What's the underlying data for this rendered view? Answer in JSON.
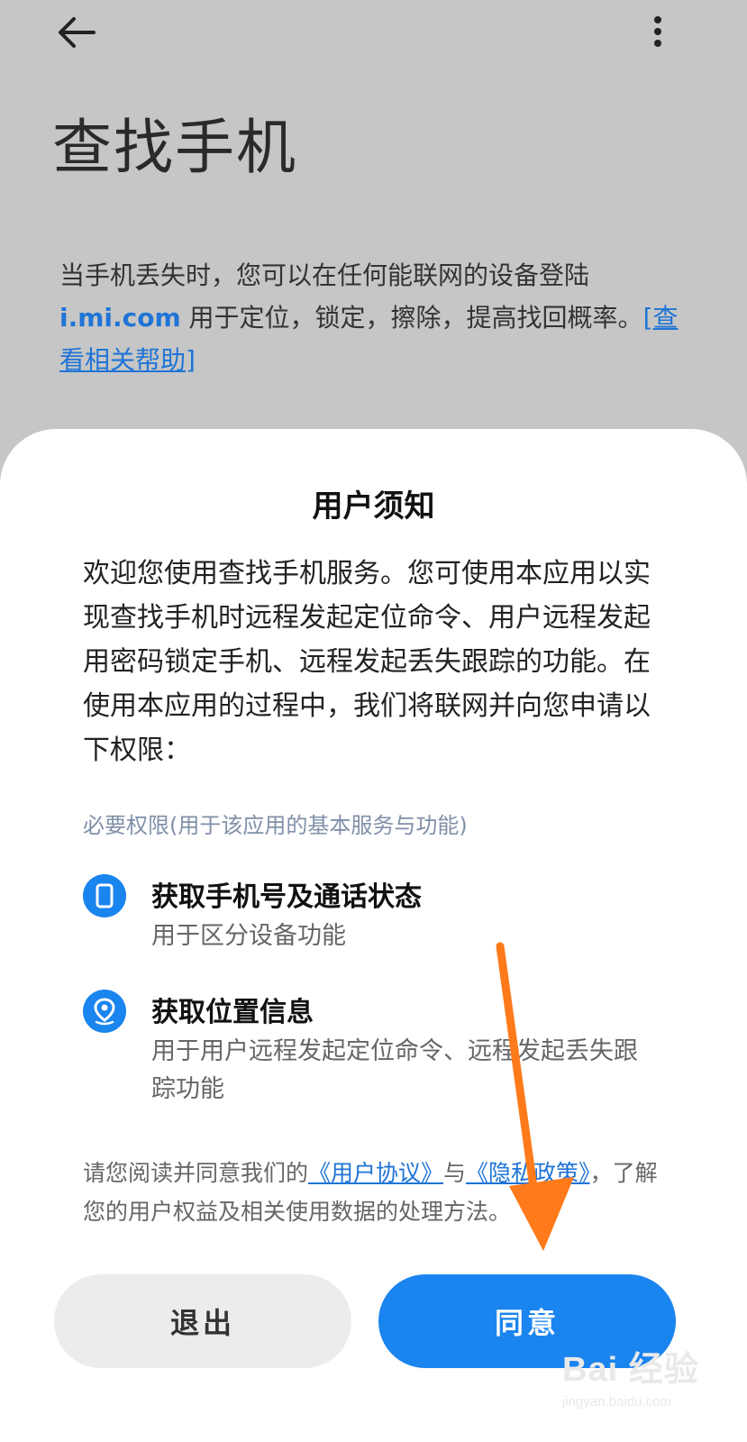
{
  "header": {
    "back_icon": "arrow-left-icon",
    "more_icon": "more-vertical-icon",
    "title": "查找手机"
  },
  "intro": {
    "text_before": "当手机丢失时，您可以在任何能联网的设备登陆",
    "domain": "i.mi.com",
    "text_after": " 用于定位，锁定，擦除，提高找回概率。",
    "help_link": "[查看相关帮助]"
  },
  "dialog": {
    "title": "用户须知",
    "body": "欢迎您使用查找手机服务。您可使用本应用以实现查找手机时远程发起定位命令、用户远程发起用密码锁定手机、远程发起丢失跟踪的功能。在使用本应用的过程中，我们将联网并向您申请以下权限：",
    "permissions_header": "必要权限(用于该应用的基本服务与功能)",
    "permissions": [
      {
        "icon": "phone-icon",
        "title": "获取手机号及通话状态",
        "desc": "用于区分设备功能"
      },
      {
        "icon": "location-pin-icon",
        "title": "获取位置信息",
        "desc": "用于用户远程发起定位命令、远程发起丢失跟踪功能"
      }
    ],
    "agreement": {
      "prefix": "请您阅读并同意我们的",
      "user_agreement": "《用户协议》",
      "and": "与",
      "privacy_policy": "《隐私政策》",
      "suffix": "，了解您的用户权益及相关使用数据的处理方法。"
    },
    "buttons": {
      "exit": "退出",
      "agree": "同意"
    }
  },
  "overlay": {
    "arrow_color": "#ff7a1a"
  },
  "watermark": {
    "main": "Bai 经验",
    "sub": "jingyan.baidu.com"
  },
  "colors": {
    "accent": "#1a84ef",
    "link": "#1f74d6",
    "background_dim": "#c6c6c6"
  }
}
